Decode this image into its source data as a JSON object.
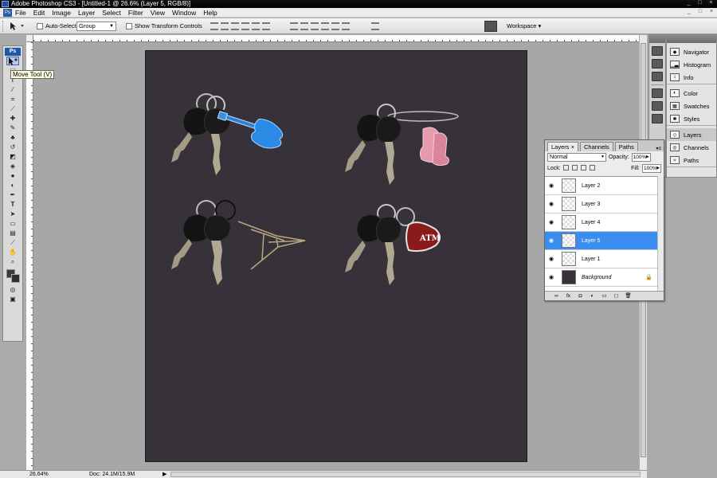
{
  "window": {
    "title": "Adobe Photoshop CS3 - [Untitled-1 @ 26.6% (Layer 5, RGB/8)]",
    "controls": [
      "_",
      "□",
      "×"
    ]
  },
  "menu": {
    "items": [
      "File",
      "Edit",
      "Image",
      "Layer",
      "Select",
      "Filter",
      "View",
      "Window",
      "Help"
    ]
  },
  "options_bar": {
    "auto_select_label": "Auto-Select:",
    "auto_select_value": "Group",
    "show_transform_label": "Show Transform Controls",
    "workspace_label": "Workspace ▾"
  },
  "toolbox": {
    "logo": "Ps",
    "tooltip": "Move Tool (V)",
    "tools": [
      "move",
      "marquee",
      "lasso",
      "quick-select",
      "crop",
      "slice",
      "healing",
      "brush",
      "clone-stamp",
      "history-brush",
      "eraser",
      "gradient",
      "blur",
      "dodge",
      "pen",
      "type",
      "path-select",
      "shape",
      "notes",
      "eyedropper",
      "hand",
      "zoom"
    ]
  },
  "status": {
    "zoom": "26.64%",
    "doc": "Doc: 24.1M/15.9M"
  },
  "dock": {
    "groups": [
      [
        "Navigator",
        "Histogram",
        "Info"
      ],
      [
        "Color",
        "Swatches",
        "Styles"
      ],
      [
        "Layers",
        "Channels",
        "Paths"
      ]
    ]
  },
  "layers_panel": {
    "tabs": [
      "Layers ×",
      "Channels",
      "Paths"
    ],
    "blend_mode": "Normal",
    "opacity_label": "Opacity:",
    "opacity_value": "100%",
    "lock_label": "Lock:",
    "fill_label": "Fill:",
    "fill_value": "100%",
    "layers": [
      {
        "name": "Layer 2",
        "selected": false
      },
      {
        "name": "Layer 3",
        "selected": false
      },
      {
        "name": "Layer 4",
        "selected": false
      },
      {
        "name": "Layer 5",
        "selected": true
      },
      {
        "name": "Layer 1",
        "selected": false
      },
      {
        "name": "Background",
        "selected": false
      }
    ],
    "footer_icons": [
      "link-icon",
      "fx-icon",
      "mask-icon",
      "adjustment-icon",
      "group-icon",
      "new-layer-icon",
      "trash-icon"
    ]
  },
  "canvas": {
    "background_color": "#37323a",
    "keychains": [
      "guitar",
      "pink-boots",
      "eiffel-tower",
      "atm-tag"
    ]
  }
}
